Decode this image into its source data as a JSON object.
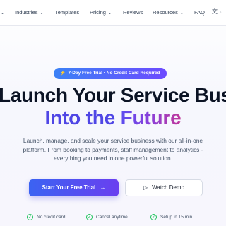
{
  "nav": {
    "items": [
      {
        "label": "Industries",
        "has_dropdown": true
      },
      {
        "label": "Templates",
        "has_dropdown": false
      },
      {
        "label": "Pricing",
        "has_dropdown": true
      },
      {
        "label": "Reviews",
        "has_dropdown": false
      },
      {
        "label": "Resources",
        "has_dropdown": true
      },
      {
        "label": "FAQ",
        "has_dropdown": false
      }
    ],
    "language_icon": "translate-icon",
    "language_label": "u",
    "chevron_icon": "chevron-down-icon"
  },
  "badge": {
    "icon": "bolt-icon",
    "text": "7-Day Free Trial • No Credit Card Required"
  },
  "hero": {
    "line1": "Launch Your Service Business",
    "line2_plain": "Into the ",
    "line2_accent": "Future",
    "subtitle_lines": [
      "Launch, manage, and scale your service business with our all-in-one",
      "platform. From booking to payments, staff management to analytics -",
      "everything you need in one powerful solution."
    ]
  },
  "cta": {
    "primary_label": "Start Your Free Trial",
    "primary_arrow": "→",
    "secondary_label": "Watch Demo",
    "secondary_icon": "play-icon"
  },
  "features": [
    {
      "label": "No credit card",
      "icon": "check-circle-icon"
    },
    {
      "label": "Cancel anytime",
      "icon": "check-circle-icon"
    },
    {
      "label": "Setup in 15 min",
      "icon": "check-circle-icon"
    }
  ],
  "colors": {
    "accent_start": "#3b63f2",
    "accent_end": "#6a3ff0",
    "headline_accent": "#8b3fd9",
    "check_green": "#22c55e"
  }
}
